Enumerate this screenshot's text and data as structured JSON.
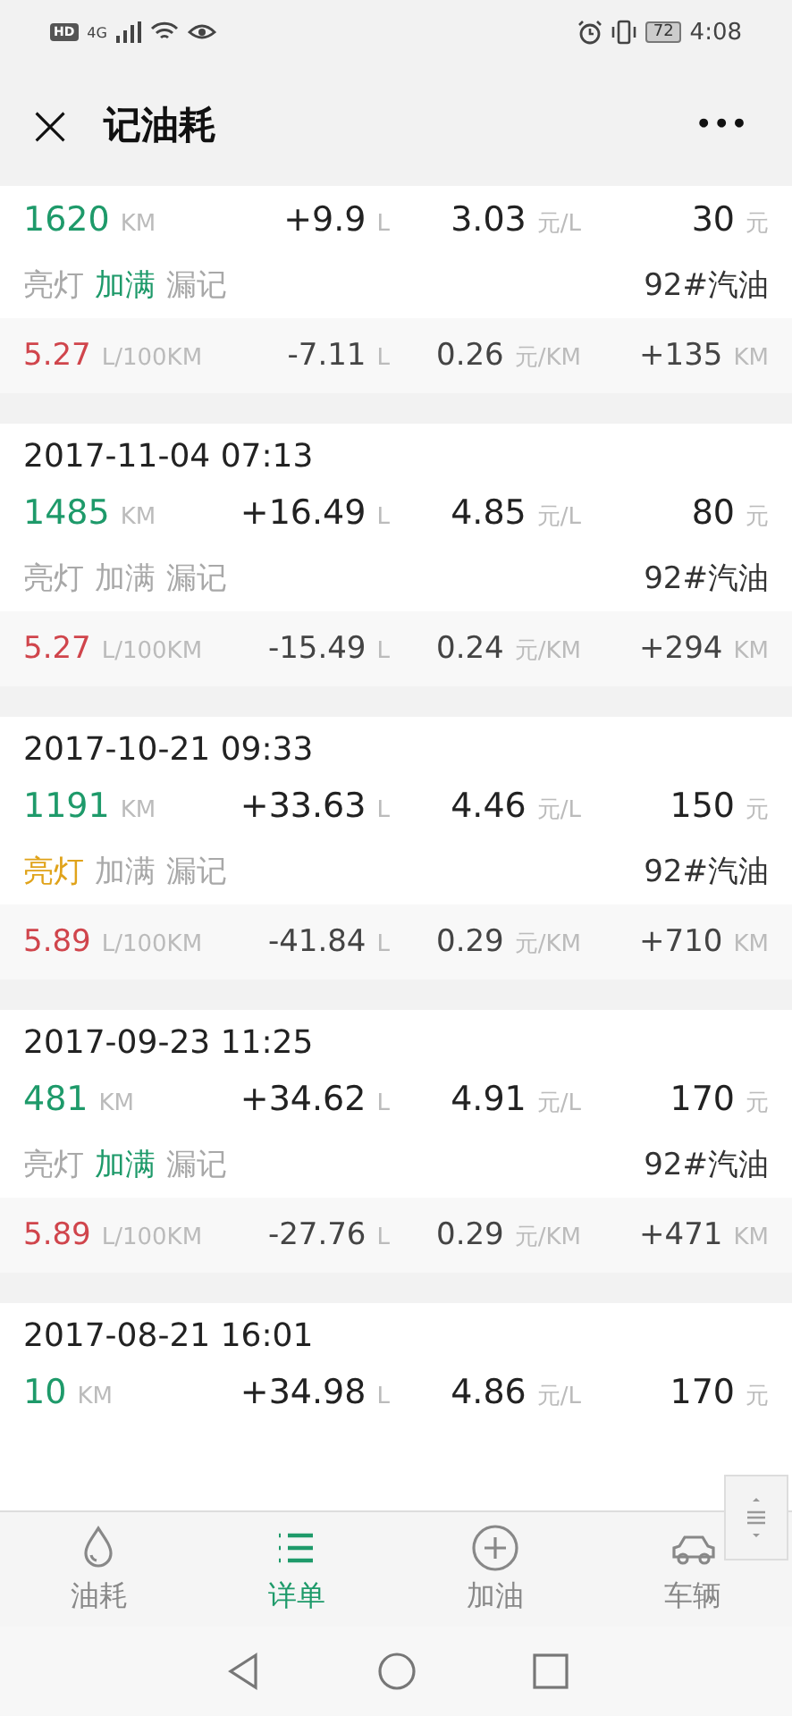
{
  "status_bar": {
    "hd": "HD",
    "network": "4G",
    "battery": "72",
    "time": "4:08"
  },
  "header": {
    "close": "×",
    "title": "记油耗",
    "menu": "•••"
  },
  "records": [
    {
      "odometer": {
        "value": "1620",
        "unit": "KM"
      },
      "fuel": {
        "value": "+9.9",
        "unit": "L"
      },
      "price": {
        "value": "3.03",
        "unit": "元/L"
      },
      "amount": {
        "value": "30",
        "unit": "元"
      },
      "tags": [
        {
          "label": "亮灯",
          "on": false
        },
        {
          "label": "加满",
          "on": true,
          "color": "#1e9a6a"
        },
        {
          "label": "漏记",
          "on": false
        }
      ],
      "fuel_type": "92#汽油",
      "stats": {
        "consumption": {
          "value": "5.27",
          "unit": "L/100KM"
        },
        "difference": {
          "value": "-7.11",
          "unit": "L"
        },
        "cost": {
          "value": "0.26",
          "unit": "元/KM"
        },
        "distance": {
          "value": "+135",
          "unit": "KM"
        }
      }
    },
    {
      "date": "2017-11-04 07:13",
      "odometer": {
        "value": "1485",
        "unit": "KM"
      },
      "fuel": {
        "value": "+16.49",
        "unit": "L"
      },
      "price": {
        "value": "4.85",
        "unit": "元/L"
      },
      "amount": {
        "value": "80",
        "unit": "元"
      },
      "tags": [
        {
          "label": "亮灯",
          "on": false
        },
        {
          "label": "加满",
          "on": false
        },
        {
          "label": "漏记",
          "on": false
        }
      ],
      "fuel_type": "92#汽油",
      "stats": {
        "consumption": {
          "value": "5.27",
          "unit": "L/100KM"
        },
        "difference": {
          "value": "-15.49",
          "unit": "L"
        },
        "cost": {
          "value": "0.24",
          "unit": "元/KM"
        },
        "distance": {
          "value": "+294",
          "unit": "KM"
        }
      }
    },
    {
      "date": "2017-10-21 09:33",
      "odometer": {
        "value": "1191",
        "unit": "KM"
      },
      "fuel": {
        "value": "+33.63",
        "unit": "L"
      },
      "price": {
        "value": "4.46",
        "unit": "元/L"
      },
      "amount": {
        "value": "150",
        "unit": "元"
      },
      "tags": [
        {
          "label": "亮灯",
          "on": true,
          "color": "#e0a31a"
        },
        {
          "label": "加满",
          "on": false
        },
        {
          "label": "漏记",
          "on": false
        }
      ],
      "fuel_type": "92#汽油",
      "stats": {
        "consumption": {
          "value": "5.89",
          "unit": "L/100KM"
        },
        "difference": {
          "value": "-41.84",
          "unit": "L"
        },
        "cost": {
          "value": "0.29",
          "unit": "元/KM"
        },
        "distance": {
          "value": "+710",
          "unit": "KM"
        }
      }
    },
    {
      "date": "2017-09-23 11:25",
      "odometer": {
        "value": "481",
        "unit": "KM"
      },
      "fuel": {
        "value": "+34.62",
        "unit": "L"
      },
      "price": {
        "value": "4.91",
        "unit": "元/L"
      },
      "amount": {
        "value": "170",
        "unit": "元"
      },
      "tags": [
        {
          "label": "亮灯",
          "on": false
        },
        {
          "label": "加满",
          "on": true,
          "color": "#1e9a6a"
        },
        {
          "label": "漏记",
          "on": false
        }
      ],
      "fuel_type": "92#汽油",
      "stats": {
        "consumption": {
          "value": "5.89",
          "unit": "L/100KM"
        },
        "difference": {
          "value": "-27.76",
          "unit": "L"
        },
        "cost": {
          "value": "0.29",
          "unit": "元/KM"
        },
        "distance": {
          "value": "+471",
          "unit": "KM"
        }
      }
    },
    {
      "date": "2017-08-21 16:01",
      "odometer": {
        "value": "10",
        "unit": "KM"
      },
      "fuel": {
        "value": "+34.98",
        "unit": "L"
      },
      "price": {
        "value": "4.86",
        "unit": "元/L"
      },
      "amount": {
        "value": "170",
        "unit": "元"
      }
    }
  ],
  "tabs": [
    {
      "label": "油耗",
      "kind": "drop",
      "selected": false
    },
    {
      "label": "详单",
      "kind": "list",
      "selected": true
    },
    {
      "label": "加油",
      "kind": "plus",
      "selected": false
    },
    {
      "label": "车辆",
      "kind": "car",
      "selected": false
    }
  ]
}
